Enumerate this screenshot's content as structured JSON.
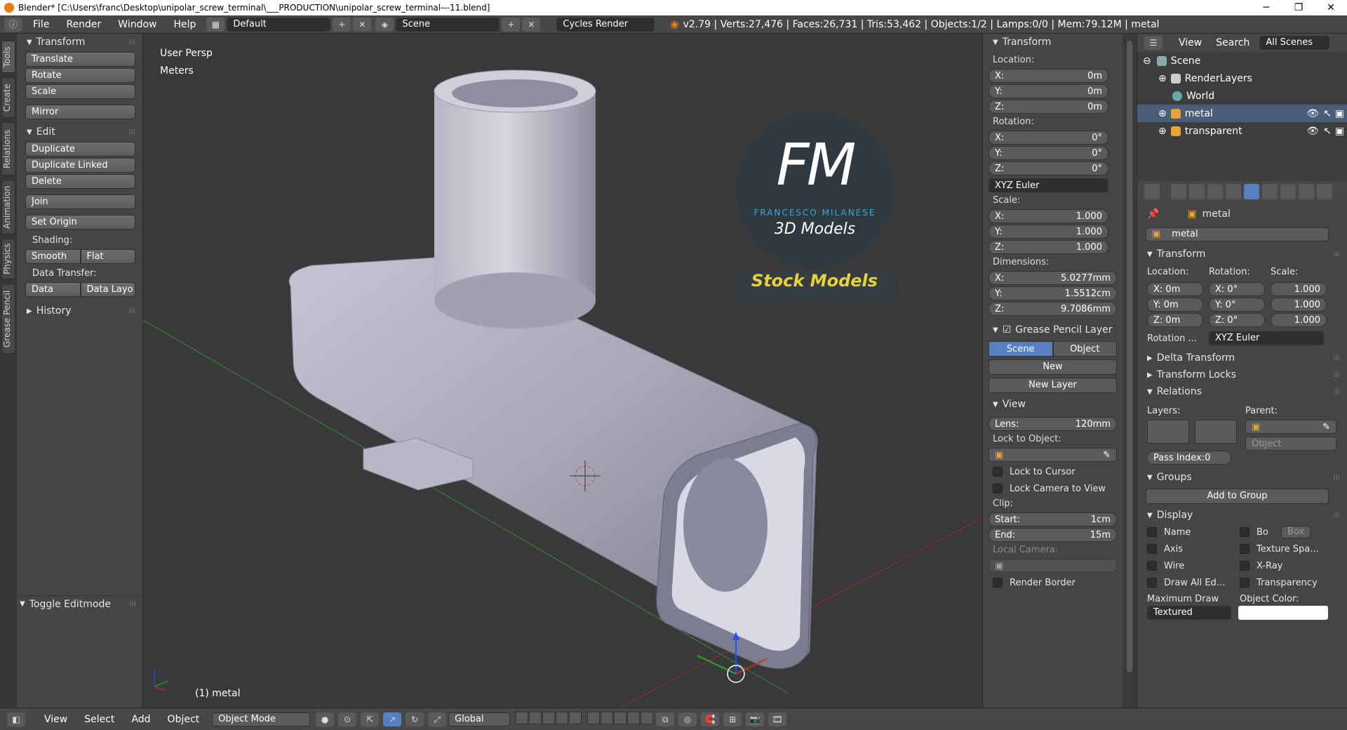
{
  "titlebar": {
    "title": "Blender* [C:\\Users\\franc\\Desktop\\unipolar_screw_terminal\\___PRODUCTION\\unipolar_screw_terminal---11.blend]",
    "minimize": "─",
    "maximize": "❐",
    "close": "✕"
  },
  "menubar": {
    "items": [
      "File",
      "Render",
      "Window",
      "Help"
    ],
    "layout": "Default",
    "scene": "Scene",
    "engine": "Cycles Render",
    "stats": "v2.79 | Verts:27,476 | Faces:26,731 | Tris:53,462 | Objects:1/2 | Lamps:0/0 | Mem:79.12M | metal"
  },
  "tabs": [
    "Tools",
    "Create",
    "Relations",
    "Animation",
    "Physics",
    "Grease Pencil"
  ],
  "toolshelf": {
    "transform_header": "Transform",
    "translate": "Translate",
    "rotate": "Rotate",
    "scale": "Scale",
    "mirror": "Mirror",
    "edit_header": "Edit",
    "duplicate": "Duplicate",
    "duplicate_linked": "Duplicate Linked",
    "delete": "Delete",
    "join": "Join",
    "set_origin": "Set Origin",
    "shading_label": "Shading:",
    "smooth": "Smooth",
    "flat": "Flat",
    "data_transfer_label": "Data Transfer:",
    "data": "Data",
    "data_layo": "Data Layo",
    "history": "History",
    "toggle_editmode": "Toggle Editmode"
  },
  "viewport": {
    "view_name": "User Persp",
    "units": "Meters",
    "object_label": "(1) metal",
    "logo_top": "FM",
    "logo_sub": "FRANCESCO MILANESE",
    "logo_models": "3D Models",
    "logo_banner": "Stock Models"
  },
  "npanel": {
    "transform_header": "Transform",
    "location_label": "Location:",
    "loc": [
      {
        "k": "X:",
        "v": "0m"
      },
      {
        "k": "Y:",
        "v": "0m"
      },
      {
        "k": "Z:",
        "v": "0m"
      }
    ],
    "rotation_label": "Rotation:",
    "rot": [
      {
        "k": "X:",
        "v": "0°"
      },
      {
        "k": "Y:",
        "v": "0°"
      },
      {
        "k": "Z:",
        "v": "0°"
      }
    ],
    "rot_mode": "XYZ Euler",
    "scale_label": "Scale:",
    "scl": [
      {
        "k": "X:",
        "v": "1.000"
      },
      {
        "k": "Y:",
        "v": "1.000"
      },
      {
        "k": "Z:",
        "v": "1.000"
      }
    ],
    "dimensions_label": "Dimensions:",
    "dim": [
      {
        "k": "X:",
        "v": "5.0277mm"
      },
      {
        "k": "Y:",
        "v": "1.5512cm"
      },
      {
        "k": "Z:",
        "v": "9.7086mm"
      }
    ],
    "gp_header": "Grease Pencil Layer",
    "gp_scene": "Scene",
    "gp_object": "Object",
    "gp_new": "New",
    "gp_new_layer": "New Layer",
    "view_header": "View",
    "lens_k": "Lens:",
    "lens_v": "120mm",
    "lock_to_object": "Lock to Object:",
    "lock_to_cursor": "Lock to Cursor",
    "lock_camera": "Lock Camera to View",
    "clip_label": "Clip:",
    "clip_start_k": "Start:",
    "clip_start_v": "1cm",
    "clip_end_k": "End:",
    "clip_end_v": "15m",
    "local_camera": "Local Camera:",
    "render_border": "Render Border"
  },
  "outliner": {
    "view": "View",
    "search": "Search",
    "scenes": "All Scenes",
    "rows": [
      "Scene",
      "RenderLayers",
      "World",
      "metal",
      "transparent"
    ]
  },
  "properties": {
    "breadcrumb": "metal",
    "name_field": "metal",
    "transform_header": "Transform",
    "location_label": "Location:",
    "rotation_label": "Rotation:",
    "scale_label": "Scale:",
    "loc": [
      "X: 0m",
      "Y: 0m",
      "Z: 0m"
    ],
    "rot": [
      "X:  0°",
      "Y:  0°",
      "Z:  0°"
    ],
    "scl": [
      "1.000",
      "1.000",
      "1.000"
    ],
    "rotation_mode_label": "Rotation ...",
    "rotation_mode": "XYZ Euler",
    "delta": "Delta Transform",
    "locks": "Transform Locks",
    "relations": "Relations",
    "layers_label": "Layers:",
    "parent_label": "Parent:",
    "parent_type": "Object",
    "pass_index": "Pass Index:0",
    "groups": "Groups",
    "add_group": "Add to Group",
    "display": "Display",
    "d_name": "Name",
    "d_axis": "Axis",
    "d_wire": "Wire",
    "d_drawall": "Draw All Ed...",
    "d_bo": "Bo",
    "d_box": "Box",
    "d_texspace": "Texture Spa...",
    "d_xray": "X-Ray",
    "d_transp": "Transparency",
    "max_draw_label": "Maximum Draw",
    "max_draw": "Textured",
    "obj_color_label": "Object Color:"
  },
  "bottombar": {
    "view": "View",
    "select": "Select",
    "add": "Add",
    "object": "Object",
    "mode": "Object Mode",
    "orientation": "Global"
  },
  "colors": {
    "accent": "#5680c2",
    "bg": "#393939",
    "panel": "#454545"
  }
}
